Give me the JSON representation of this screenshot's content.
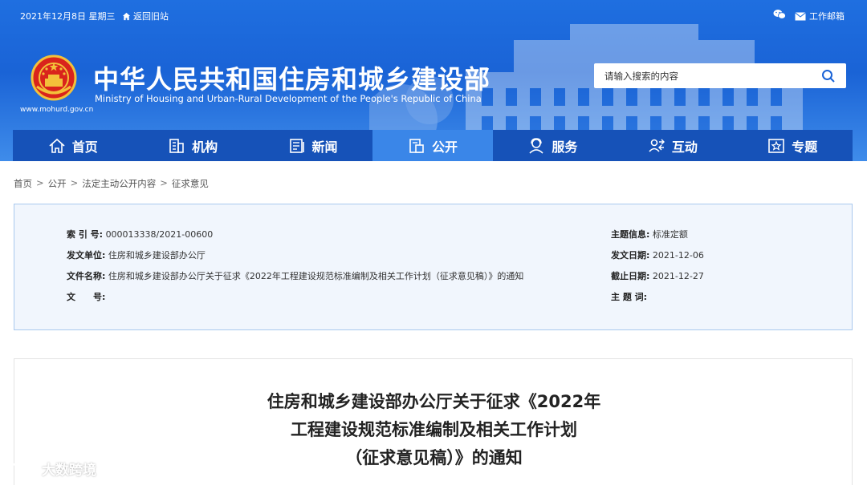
{
  "topbar": {
    "date": "2021年12月8日 星期三",
    "home_link": "返回旧站",
    "wechat_icon": "wechat-icon",
    "mail_label": "工作邮箱"
  },
  "header": {
    "title": "中华人民共和国住房和城乡建设部",
    "subtitle": "Ministry of Housing and Urban-Rural Development of the People's Republic of China",
    "domain": "www.mohurd.gov.cn",
    "search_placeholder": "请输入搜索的内容"
  },
  "nav": [
    {
      "label": "首页",
      "icon": "home-icon"
    },
    {
      "label": "机构",
      "icon": "building-icon"
    },
    {
      "label": "新闻",
      "icon": "news-icon"
    },
    {
      "label": "公开",
      "icon": "document-icon",
      "active": true
    },
    {
      "label": "服务",
      "icon": "service-icon"
    },
    {
      "label": "互动",
      "icon": "interaction-icon"
    },
    {
      "label": "专题",
      "icon": "star-icon"
    }
  ],
  "breadcrumb": [
    "首页",
    "公开",
    "法定主动公开内容",
    "征求意见"
  ],
  "meta": {
    "index_label": "索 引 号:",
    "index_value": "000013338/2021-00600",
    "issuer_label": "发文单位:",
    "issuer_value": "住房和城乡建设部办公厅",
    "filename_label": "文件名称:",
    "filename_value": "住房和城乡建设部办公厅关于征求《2022年工程建设规范标准编制及相关工作计划（征求意见稿）》的通知",
    "docno_label": "文　　号:",
    "docno_value": "",
    "topic_label": "主题信息:",
    "topic_value": "标准定额",
    "date_label": "发文日期:",
    "date_value": "2021-12-06",
    "deadline_label": "截止日期:",
    "deadline_value": "2021-12-27",
    "keywords_label": "主 题 词:",
    "keywords_value": ""
  },
  "article": {
    "title_line1": "住房和城乡建设部办公厅关于征求《2022年",
    "title_line2": "工程建设规范标准编制及相关工作计划",
    "title_line3": "（征求意见稿）》的通知"
  },
  "watermark": "大数跨境",
  "colors": {
    "header_blue": "#1a63d6",
    "nav_blue": "#1652b8",
    "nav_active": "#3a86e8",
    "meta_bg": "#f1f6fd",
    "meta_border": "#a9c8ee"
  }
}
